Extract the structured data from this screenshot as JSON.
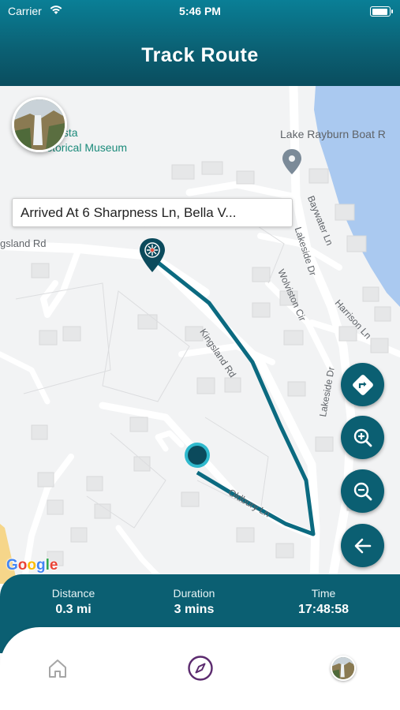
{
  "status_bar": {
    "carrier": "Carrier",
    "time": "5:46 PM"
  },
  "header": {
    "title": "Track Route"
  },
  "map": {
    "labels": {
      "museum": "a Vista",
      "museum_line2": "istorical Museum",
      "lake": "Lake Rayburn Boat R",
      "kingsland_left": "gsland Rd",
      "kingsland_diag": "Kingsland Rd",
      "baywater": "Baywater Ln",
      "lakeside_top": "Lakeside Dr",
      "lakeside_bottom": "Lakeside Dr",
      "wolviston": "Wolviston Cir",
      "harrison": "Harrison Ln",
      "oldbury": "Oldbury Ln"
    },
    "arrived_callout": "Arrived At 6 Sharpness Ln, Bella V...",
    "google_logo": "Google",
    "route_color": "#0b6a80",
    "water_color": "#aac9f0",
    "controls": {
      "directions": "directions-icon",
      "zoom_in": "zoom-in-icon",
      "zoom_out": "zoom-out-icon",
      "back": "arrow-back-icon"
    }
  },
  "stats": {
    "distance_label": "Distance",
    "distance_value": "0.3 mi",
    "duration_label": "Duration",
    "duration_value": "3 mins",
    "time_label": "Time",
    "time_value": "17:48:58"
  },
  "bottom_nav": {
    "items": [
      {
        "icon": "home-icon"
      },
      {
        "icon": "compass-icon",
        "active": true,
        "color": "#5b2a6e"
      },
      {
        "icon": "profile-avatar"
      }
    ]
  }
}
